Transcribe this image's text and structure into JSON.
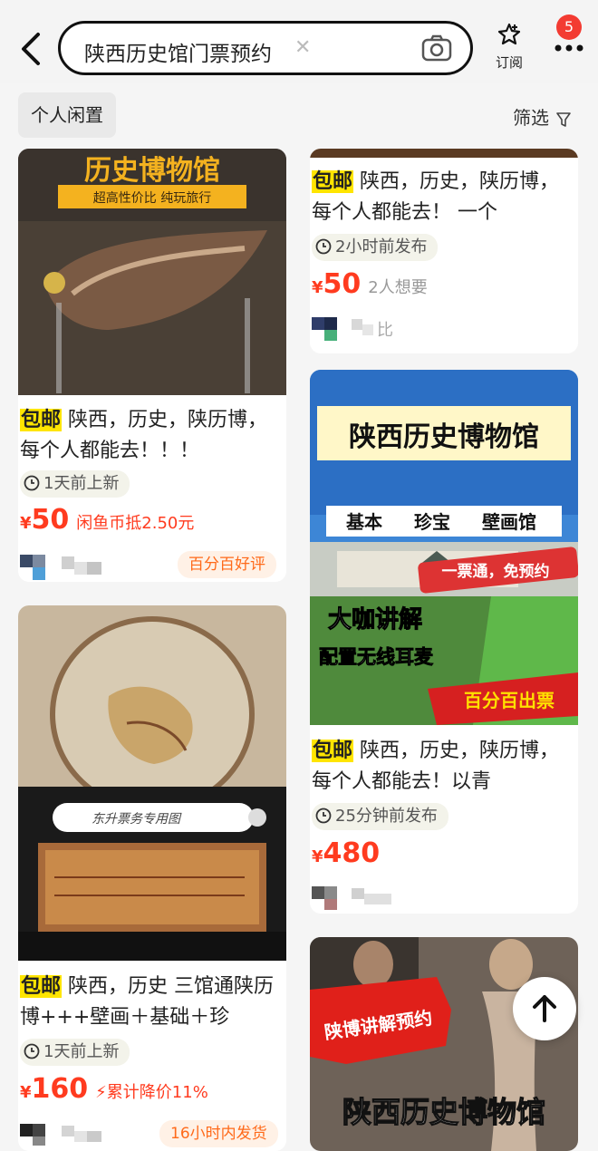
{
  "header": {
    "back_icon": "back-arrow-icon",
    "search_query": "陕西历史馆门票预约",
    "clear_icon": "clear-icon",
    "camera_icon": "camera-icon",
    "subscribe_label": "订阅",
    "notification_count": "5"
  },
  "filters": {
    "chip_label": "个人闲置",
    "filter_label": "筛选"
  },
  "cards": [
    {
      "free_shipping": "包邮",
      "title": "陕西，历史，陕历博，每个人都能去！！！",
      "time": "1天前上新",
      "price": "50",
      "extra": "闲鱼币抵2.50元",
      "badge": "百分百好评",
      "image_text": [
        "历史博物馆",
        "超高性价比  纯玩旅行"
      ]
    },
    {
      "free_shipping": "包邮",
      "title": "陕西，历史，陕历博，每个人都能去！ 一个",
      "time": "2小时前发布",
      "price": "50",
      "extra": "2人想要",
      "seller_suffix": "比"
    },
    {
      "image_text": [
        "陕西历史博物馆",
        "基本",
        "珍宝",
        "壁画馆",
        "一票通，免预约",
        "大咖讲解",
        "配置无线耳麦",
        "百分百出票"
      ],
      "free_shipping": "包邮",
      "title": "陕西，历史，陕历博，每个人都能去！以青",
      "time": "25分钟前发布",
      "price": "480"
    },
    {
      "image_text": [
        "东升票务专用图"
      ],
      "free_shipping": "包邮",
      "title": "陕西，历史 三馆通陕历博+++壁画＋基础＋珍",
      "time": "1天前上新",
      "price": "160",
      "extra": "累计降价11%",
      "badge": "16小时内发货"
    },
    {
      "image_text": [
        "陕博讲解预约",
        "陕西历史博物馆"
      ]
    }
  ],
  "colors": {
    "price": "#ff3b1f",
    "tag_yellow": "#ffe500",
    "badge_red": "#f33b32"
  }
}
